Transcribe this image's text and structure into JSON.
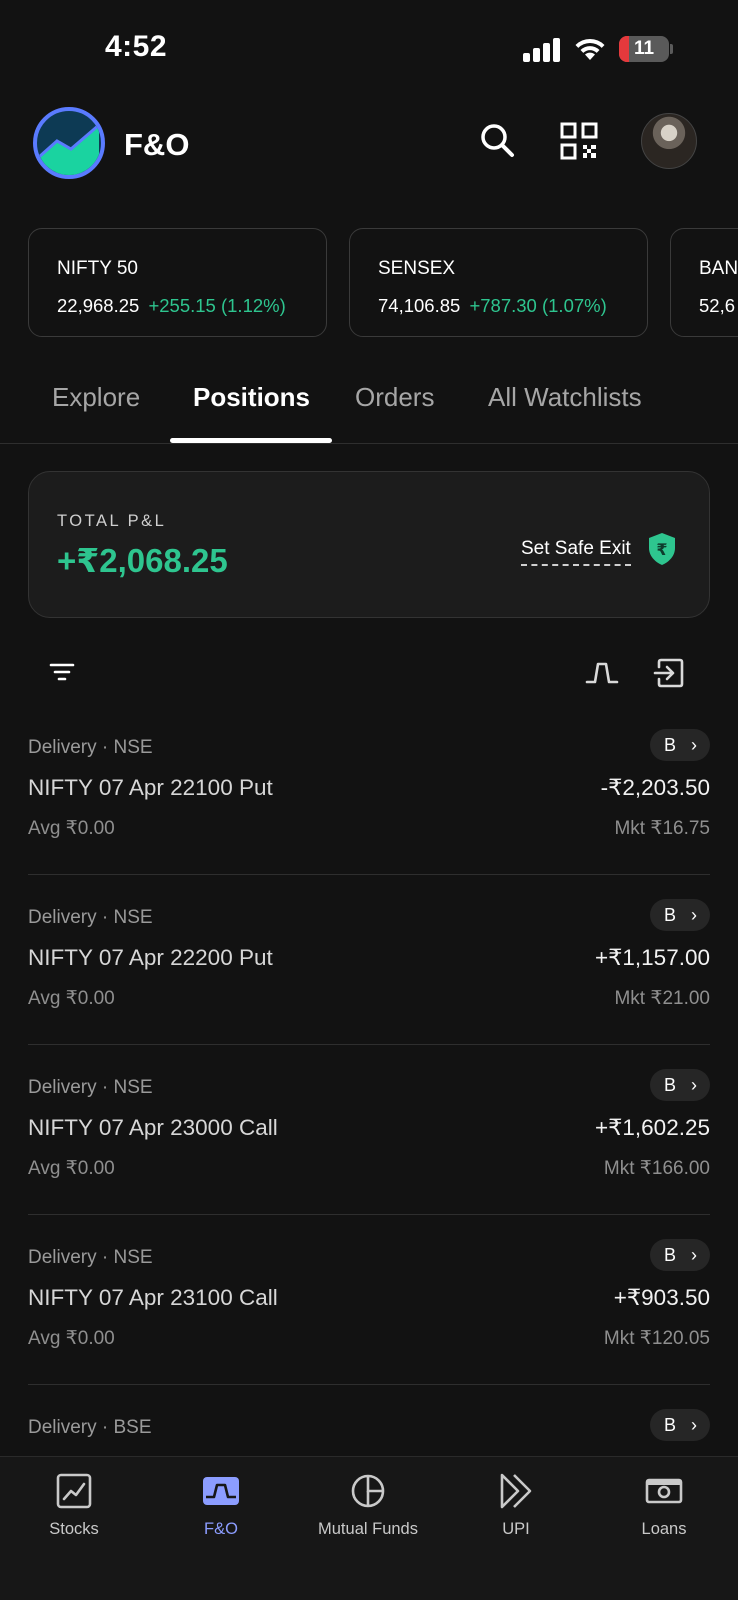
{
  "status_bar": {
    "time": "4:52",
    "battery": "11",
    "battery_level": 0.11
  },
  "header": {
    "title": "F&O",
    "icons": [
      "search-icon",
      "qr-code-icon",
      "profile-avatar"
    ]
  },
  "indices": [
    {
      "name": "NIFTY 50",
      "value": "22,968.25",
      "change": "+255.15 (1.12%)"
    },
    {
      "name": "SENSEX",
      "value": "74,106.85",
      "change": "+787.30 (1.07%)"
    },
    {
      "name": "BAN",
      "value": "52,6",
      "change": ""
    }
  ],
  "tabs": [
    {
      "label": "Explore"
    },
    {
      "label": "Positions"
    },
    {
      "label": "Orders"
    },
    {
      "label": "All Watchlists"
    }
  ],
  "active_tab": "Positions",
  "pnl": {
    "label": "TOTAL P&L",
    "value": "+₹2,068.25",
    "safe_exit": "Set Safe Exit"
  },
  "positions": [
    {
      "meta": "Delivery · NSE",
      "name": "NIFTY 07 Apr 22100 Put",
      "avg": "Avg ₹0.00",
      "badge": "B",
      "pnl": "-₹2,203.50",
      "ltp": "Mkt ₹16.75"
    },
    {
      "meta": "Delivery · NSE",
      "name": "NIFTY 07 Apr 22200 Put",
      "avg": "Avg ₹0.00",
      "badge": "B",
      "pnl": "+₹1,157.00",
      "ltp": "Mkt ₹21.00"
    },
    {
      "meta": "Delivery · NSE",
      "name": "NIFTY 07 Apr 23000 Call",
      "avg": "Avg ₹0.00",
      "badge": "B",
      "pnl": "+₹1,602.25",
      "ltp": "Mkt ₹166.00"
    },
    {
      "meta": "Delivery · NSE",
      "name": "NIFTY 07 Apr 23100 Call",
      "avg": "Avg ₹0.00",
      "badge": "B",
      "pnl": "+₹903.50",
      "ltp": "Mkt ₹120.05"
    },
    {
      "meta": "Delivery · BSE",
      "name": "",
      "avg": "",
      "badge": "B",
      "pnl": "",
      "ltp": ""
    }
  ],
  "bottom_nav": [
    {
      "label": "Stocks",
      "icon": "stocks-chart-icon"
    },
    {
      "label": "F&O",
      "icon": "fno-icon"
    },
    {
      "label": "Mutual Funds",
      "icon": "pie-chart-icon"
    },
    {
      "label": "UPI",
      "icon": "upi-icon"
    },
    {
      "label": "Loans",
      "icon": "loans-icon"
    }
  ],
  "colors": {
    "positive": "#2ec58f",
    "accent": "#8c9dff",
    "background": "#121212",
    "battery_low": "#e5393c"
  }
}
